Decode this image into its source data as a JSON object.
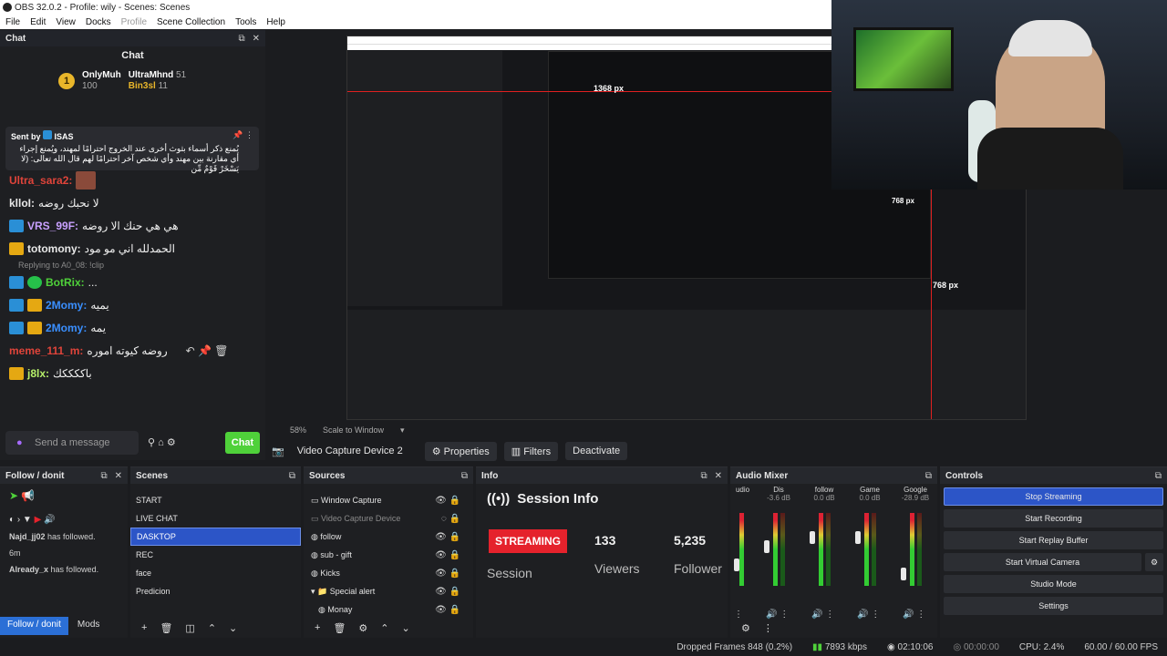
{
  "window": {
    "title": "OBS 32.0.2 - Profile: wily - Scenes: Scenes"
  },
  "menu": {
    "file": "File",
    "edit": "Edit",
    "view": "View",
    "docks": "Docks",
    "profile": "Profile",
    "scene_collection": "Scene Collection",
    "tools": "Tools",
    "help": "Help"
  },
  "chat": {
    "dock_title": "Chat",
    "title": "Chat",
    "leaders": [
      {
        "rank": "1",
        "name": "OnlyMuh",
        "points": "100"
      },
      {
        "name": "UltraMhnd",
        "points": "51"
      },
      {
        "name": "Bin3sl",
        "points": "11"
      }
    ],
    "pinned": {
      "sent_by": "Sent by",
      "user": "ISAS",
      "message": "يُمنع ذكر أسماء بثوث أخرى عند الخروج احترامًا لمهند، ويُمنع إجراء أي مقارنة بين مهند وأي شخص آخر احترامًا لهم قال الله تعالى: (لا يَسْخَرْ قَوْمٌ مِّن"
    },
    "lines": [
      {
        "user": "Ultra_sara2:",
        "text": "",
        "color": "#e0443a"
      },
      {
        "user": "klloI:",
        "text": "لا نحبك روضه",
        "color": "#e8e8e8"
      },
      {
        "user": "VRS_99F:",
        "text": "هي هي حنك الا روضه",
        "color": "#c9a0ff"
      },
      {
        "user": "totomony:",
        "text": "الحمدلله اني مو مود",
        "color": "#e8e8e8"
      },
      {
        "user": "BotRix:",
        "text": "...",
        "color": "#4fd13a"
      },
      {
        "user": "2Momy:",
        "text": "يميه",
        "color": "#3a8fff"
      },
      {
        "user": "2Momy:",
        "text": "يمه",
        "color": "#3a8fff"
      },
      {
        "user": "meme_111_m:",
        "text": "روضه كيوته اموره",
        "color": "#e0443a"
      },
      {
        "user": "j8lx:",
        "text": "باككككك",
        "color": "#b7f06a"
      }
    ],
    "reply_note": "Replying to A0_08: !clip",
    "input_placeholder": "Send a message",
    "send_label": "Chat"
  },
  "preview": {
    "zoom": "58%",
    "scale": "Scale to Window",
    "px_label_1": "768 px",
    "px_label_2": "768 px",
    "px_label_3": "1368 px"
  },
  "source_toolbar": {
    "source": "Video Capture Device 2",
    "properties": "Properties",
    "filters": "Filters",
    "deactivate": "Deactivate"
  },
  "follow": {
    "title": "Follow / donit",
    "items": [
      {
        "name": "Najd_jj02",
        "text": "has followed."
      },
      {
        "name": "Already_x",
        "text": "has followed."
      }
    ],
    "time": "6m",
    "tab_follow": "Follow / donit",
    "tab_mods": "Mods"
  },
  "scenes": {
    "title": "Scenes",
    "items": [
      "START",
      "LIVE CHAT",
      "DASKTOP",
      "REC",
      "face",
      "Predicion"
    ],
    "selected": 2
  },
  "sources": {
    "title": "Sources",
    "items": [
      "Window Capture",
      "Video Capture Device",
      "follow",
      "sub - gift",
      "Kicks",
      "Special alert",
      "Monay"
    ]
  },
  "info": {
    "title": "Info",
    "session_title": "Session Info",
    "status": "STREAMING",
    "session_label": "Session",
    "viewers_value": "133",
    "viewers_label": "Viewers",
    "followers_value": "5,235",
    "followers_label": "Follower"
  },
  "mixer": {
    "title": "Audio Mixer",
    "channels": [
      {
        "name": "udio",
        "db": ""
      },
      {
        "name": "Dis",
        "db": "-3.6 dB"
      },
      {
        "name": "follow",
        "db": "0.0 dB"
      },
      {
        "name": "Game",
        "db": "0.0 dB"
      },
      {
        "name": "Google",
        "db": "-28.9 dB"
      }
    ],
    "scale": [
      "-5",
      "-10",
      "-15",
      "-20",
      "-25",
      "-30",
      "-35",
      "-40",
      "-45",
      "-50",
      "-55",
      "-60"
    ]
  },
  "controls": {
    "title": "Controls",
    "stop_streaming": "Stop Streaming",
    "start_recording": "Start Recording",
    "replay_buffer": "Start Replay Buffer",
    "virtual_camera": "Start Virtual Camera",
    "studio_mode": "Studio Mode",
    "settings": "Settings"
  },
  "status": {
    "dropped": "Dropped Frames 848 (0.2%)",
    "bitrate": "7893 kbps",
    "stream_time": "02:10:06",
    "rec_time": "00:00:00",
    "cpu": "CPU: 2.4%",
    "fps": "60.00 / 60.00 FPS"
  }
}
